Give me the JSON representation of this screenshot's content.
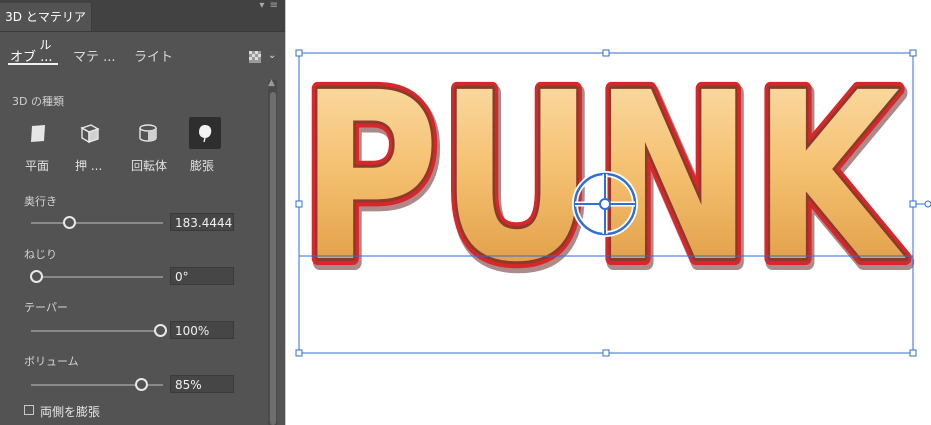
{
  "panel": {
    "tab_title": "3D とマテリアル",
    "menu_icon": "panel-menu-icon",
    "subtabs": [
      "オブ ...",
      "マテ ...",
      "ライト"
    ],
    "type_heading": "3D の種類",
    "types": [
      {
        "label": "平面",
        "icon": "plane-icon"
      },
      {
        "label": "押 ...",
        "icon": "extrude-icon"
      },
      {
        "label": "回転体",
        "icon": "revolve-icon"
      },
      {
        "label": "膨張",
        "icon": "inflate-icon",
        "selected": true
      }
    ],
    "depth": {
      "label": "奥行き",
      "value": "183.4444",
      "position": 0.27
    },
    "twist": {
      "label": "ねじり",
      "value": "0°",
      "position": 0.0
    },
    "taper": {
      "label": "テーパー",
      "value": "100%",
      "position": 1.0
    },
    "volume": {
      "label": "ボリューム",
      "value": "85%",
      "position": 0.85
    },
    "inflate_both": {
      "label": "両側を膨張",
      "checked": false
    }
  },
  "canvas": {
    "artwork_text": "PUNK",
    "colors": {
      "fill": "#f4be6a",
      "outline": "#d9262a",
      "selection": "#2f6fd6"
    }
  }
}
